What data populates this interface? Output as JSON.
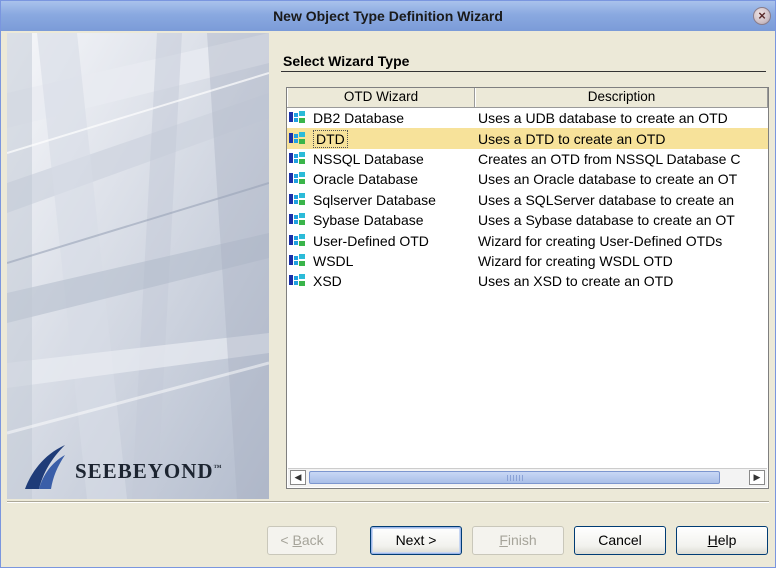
{
  "window": {
    "title": "New Object Type Definition Wizard",
    "close_glyph": "×"
  },
  "branding": {
    "logo_text": "SeeBeyond",
    "logo_text_display": "SEEBEYOND",
    "trademark": "™"
  },
  "section": {
    "title": "Select Wizard Type"
  },
  "table": {
    "columns": [
      "OTD Wizard",
      "Description"
    ],
    "rows": [
      {
        "name": "DB2 Database",
        "description": "Uses a UDB database to create an OTD"
      },
      {
        "name": "DTD",
        "description": "Uses a DTD to create an OTD",
        "selected": true
      },
      {
        "name": "NSSQL Database",
        "description": "Creates an OTD from NSSQL Database C"
      },
      {
        "name": "Oracle Database",
        "description": "Uses an Oracle database to create an OT"
      },
      {
        "name": "Sqlserver Database",
        "description": "Uses a SQLServer database to create an"
      },
      {
        "name": "Sybase Database",
        "description": "Uses a Sybase database to create an OT"
      },
      {
        "name": "User-Defined OTD",
        "description": "Wizard for creating User-Defined OTDs"
      },
      {
        "name": "WSDL",
        "description": "Wizard for creating WSDL OTD"
      },
      {
        "name": "XSD",
        "description": "Uses an XSD to create an OTD"
      }
    ],
    "row_icon": "otd-wizard-icon",
    "selected_row_color": "#f7e29a"
  },
  "scrollbar": {
    "left_arrow": "◀",
    "right_arrow": "▶"
  },
  "buttons": {
    "back": {
      "prefix": "< ",
      "mnemonic": "B",
      "rest": "ack",
      "enabled": false
    },
    "next": {
      "label": "Next >",
      "enabled": true,
      "default": true
    },
    "finish": {
      "mnemonic": "F",
      "rest": "inish",
      "enabled": false
    },
    "cancel": {
      "label": "Cancel",
      "enabled": true
    },
    "help": {
      "mnemonic": "H",
      "rest": "elp",
      "enabled": true
    }
  },
  "colors": {
    "titlebar": "#8aa9e0",
    "dialog_bg": "#ece9d8",
    "button_border": "#003c74"
  }
}
